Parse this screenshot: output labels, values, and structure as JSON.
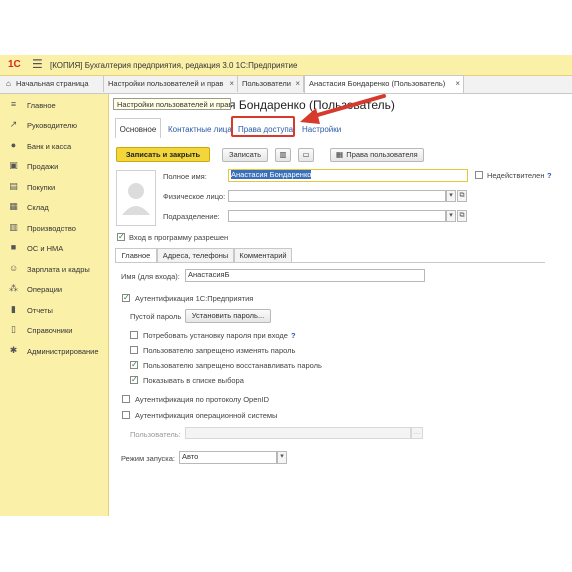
{
  "app": {
    "logo": "1С",
    "title": "[КОПИЯ] Бухгалтерия предприятия, редакция 3.0 1С:Предприятие"
  },
  "tabs": [
    {
      "label": "Начальная страница",
      "icon": "home-icon"
    },
    {
      "label": "Настройки пользователей и прав"
    },
    {
      "label": "Пользователи"
    },
    {
      "label": "Анастасия Бондаренко (Пользователь)"
    }
  ],
  "sidebar": {
    "items": [
      {
        "label": "Главное",
        "icon": "list-icon"
      },
      {
        "label": "Руководителю",
        "icon": "trend-icon"
      },
      {
        "label": "Банк и касса",
        "icon": "coin-icon"
      },
      {
        "label": "Продажи",
        "icon": "cart-icon"
      },
      {
        "label": "Покупки",
        "icon": "basket-icon"
      },
      {
        "label": "Склад",
        "icon": "warehouse-icon"
      },
      {
        "label": "Производство",
        "icon": "factory-icon"
      },
      {
        "label": "ОС и НМА",
        "icon": "truck-icon"
      },
      {
        "label": "Зарплата и кадры",
        "icon": "people-icon"
      },
      {
        "label": "Операции",
        "icon": "operations-icon"
      },
      {
        "label": "Отчеты",
        "icon": "report-icon"
      },
      {
        "label": "Справочники",
        "icon": "books-icon"
      },
      {
        "label": "Администрирование",
        "icon": "gear-icon"
      }
    ]
  },
  "form": {
    "tooltip": "Настройки пользователей и прав",
    "title_partial": "я Бондаренко (Пользователь)",
    "links": {
      "main": "Основное",
      "contacts": "Контактные лица",
      "rights": "Права доступа",
      "settings": "Настройки"
    },
    "buttons": {
      "save_close": "Записать и закрыть",
      "save": "Записать",
      "user_rights": "Права пользователя"
    },
    "fields": {
      "full_name_label": "Полное имя:",
      "full_name_value": "Анастасия Бондаренко",
      "inactive_label": "Недействителен",
      "help": "?",
      "person_label": "Физическое лицо:",
      "person_value": "",
      "department_label": "Подразделение:",
      "department_value": ""
    },
    "login_allowed": "Вход в программу разрешен",
    "subtabs": [
      "Главное",
      "Адреса, телефоны",
      "Комментарий"
    ],
    "main_tab": {
      "login_name_label": "Имя (для входа):",
      "login_name_value": "АнастасияБ",
      "auth_1c": "Аутентификация 1С:Предприятия",
      "empty_password": "Пустой пароль",
      "set_password": "Установить пароль...",
      "require_password_setup": "Потребовать установку пароля при входе",
      "deny_change_password": "Пользователю запрещено изменять пароль",
      "deny_restore_password": "Пользователю запрещено восстанавливать пароль",
      "show_in_list": "Показывать в списке выбора",
      "auth_openid": "Аутентификация по протоколу OpenID",
      "auth_os": "Аутентификация операционной системы",
      "os_user_label": "Пользователь:",
      "os_user_value": "",
      "run_mode_label": "Режим запуска:",
      "run_mode_value": "Авто"
    },
    "checks": {
      "inactive": false,
      "login_allowed": true,
      "auth_1c": true,
      "require_password_setup": false,
      "deny_change_password": false,
      "deny_restore_password": true,
      "show_in_list": true,
      "auth_openid": false,
      "auth_os": false
    }
  },
  "colors": {
    "sidebar_bg": "#fbf0a8",
    "accent_button": "#f3d73a",
    "link": "#2a5aa8",
    "highlight": "#d7392c"
  }
}
